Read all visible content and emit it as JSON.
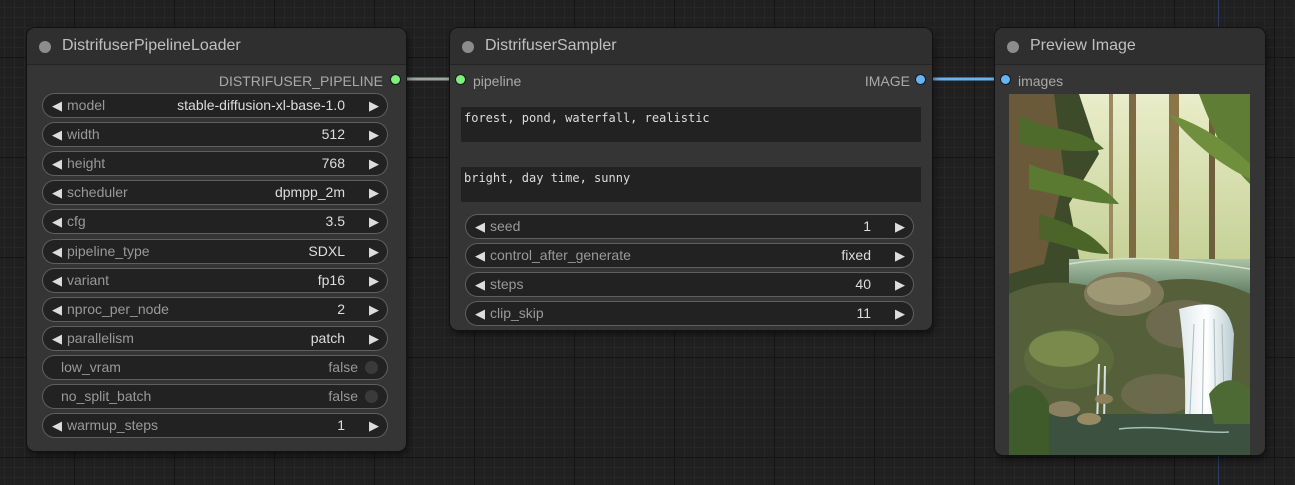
{
  "nodes": {
    "loader": {
      "title": "DistrifuserPipelineLoader",
      "output_label": "DISTRIFUSER_PIPELINE",
      "widgets": [
        {
          "label": "model",
          "value": "stable-diffusion-xl-base-1.0"
        },
        {
          "label": "width",
          "value": "512"
        },
        {
          "label": "height",
          "value": "768"
        },
        {
          "label": "scheduler",
          "value": "dpmpp_2m"
        },
        {
          "label": "cfg",
          "value": "3.5"
        },
        {
          "label": "pipeline_type",
          "value": "SDXL"
        },
        {
          "label": "variant",
          "value": "fp16"
        },
        {
          "label": "nproc_per_node",
          "value": "2"
        },
        {
          "label": "parallelism",
          "value": "patch"
        },
        {
          "label": "low_vram",
          "value": "false"
        },
        {
          "label": "no_split_batch",
          "value": "false"
        },
        {
          "label": "warmup_steps",
          "value": "1"
        }
      ]
    },
    "sampler": {
      "title": "DistrifuserSampler",
      "input_label": "pipeline",
      "output_label": "IMAGE",
      "positive_prompt": "forest, pond, waterfall, realistic",
      "negative_prompt": "bright, day time, sunny",
      "widgets": [
        {
          "label": "seed",
          "value": "1"
        },
        {
          "label": "control_after_generate",
          "value": "fixed"
        },
        {
          "label": "steps",
          "value": "40"
        },
        {
          "label": "clip_skip",
          "value": "11"
        }
      ]
    },
    "preview": {
      "title": "Preview Image",
      "input_label": "images"
    }
  },
  "colors": {
    "pipeline_link": "#9ba8a0",
    "image_link": "#64b5f6",
    "pipeline_slot": "#7cf07c",
    "image_slot": "#64b5f6"
  },
  "icons": {
    "decrement": "left-triangle",
    "increment": "right-triangle",
    "collapse": "node-dot"
  }
}
